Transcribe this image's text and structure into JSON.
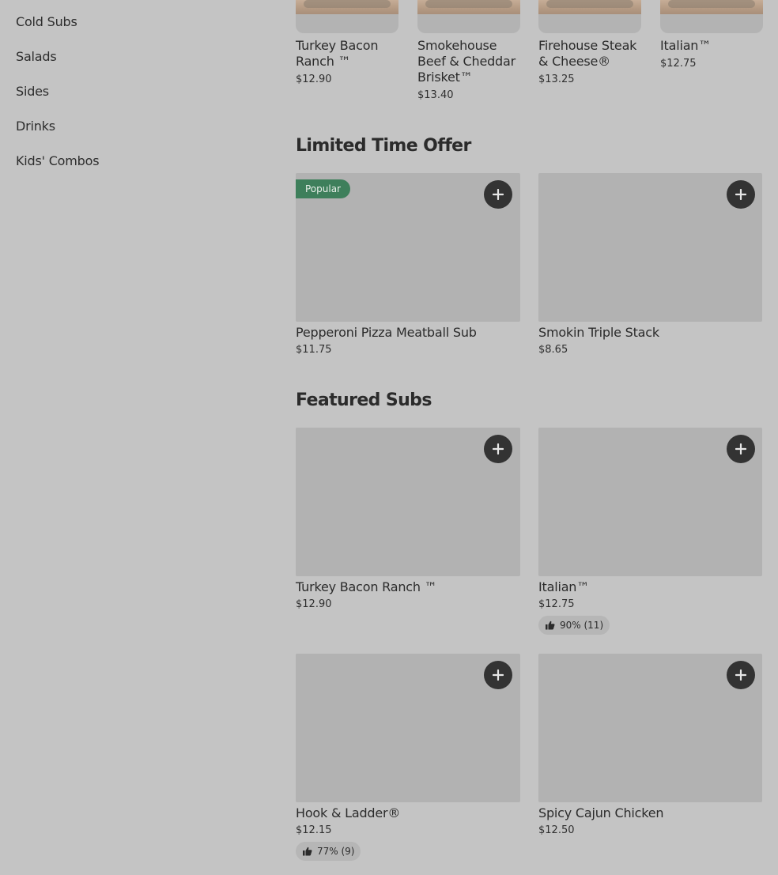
{
  "sidebar": {
    "items": [
      {
        "label": "Cold Subs"
      },
      {
        "label": "Salads"
      },
      {
        "label": "Sides"
      },
      {
        "label": "Drinks"
      },
      {
        "label": "Kids' Combos"
      }
    ]
  },
  "top_row": [
    {
      "name": "Turkey Bacon Ranch ™",
      "price": "$12.90"
    },
    {
      "name": "Smokehouse Beef & Cheddar Brisket™",
      "price": "$13.40"
    },
    {
      "name": "Firehouse Steak & Cheese®",
      "price": "$13.25"
    },
    {
      "name": "Italian™",
      "price": "$12.75"
    }
  ],
  "limited_time": {
    "title": "Limited Time Offer",
    "items": [
      {
        "name": "Pepperoni Pizza Meatball Sub",
        "price": "$11.75",
        "badge": "Popular"
      },
      {
        "name": "Smokin Triple Stack",
        "price": "$8.65"
      }
    ]
  },
  "featured": {
    "title": "Featured Subs",
    "items": [
      {
        "name": "Turkey Bacon Ranch ™",
        "price": "$12.90"
      },
      {
        "name": "Italian™",
        "price": "$12.75",
        "rating": "90% (11)"
      },
      {
        "name": "Hook & Ladder®",
        "price": "$12.15",
        "rating": "77% (9)"
      },
      {
        "name": "Spicy Cajun Chicken",
        "price": "$12.50"
      }
    ]
  },
  "colors": {
    "badge": "#3e7f5b",
    "add_button": "#333333",
    "overlay": "#c4c4c4"
  }
}
